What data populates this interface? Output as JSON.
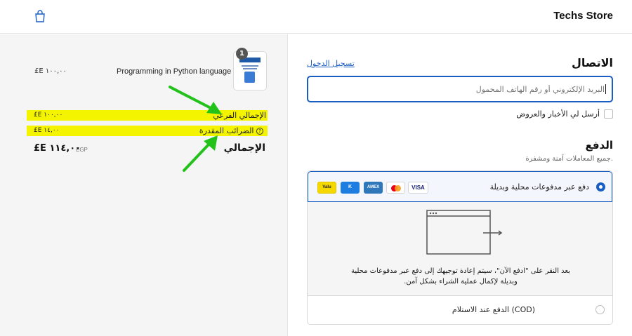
{
  "header": {
    "store_name": "Techs Store",
    "cart_icon": "shopping-bag-icon"
  },
  "summary": {
    "product": {
      "name": "Programming in Python language",
      "price": "£E ١٠٠,٠٠",
      "quantity": "1"
    },
    "subtotal_label": "الإجمالي الفرعي",
    "subtotal_value": "£E ١٠٠,٠٠",
    "tax_label": "الضرائب المقدرة",
    "tax_value": "£E ١٤,٠٠",
    "total_label": "الإجمالي",
    "total_currency": "EGP",
    "total_value": "£E ١١٤,٠٠",
    "highlight_color": "#f4f400",
    "arrow_color": "#22c21a"
  },
  "contact": {
    "title": "الاتصال",
    "login_link": "تسجيل الدخول",
    "email_placeholder": "البريد الإلكتروني أو رقم الهاتف المحمول",
    "newsletter_label": "أرسل لي الأخبار والعروض",
    "newsletter_checked": false
  },
  "payment": {
    "title": "الدفع",
    "subtitle": "جميع المعاملات آمنة ومشفرة.",
    "option_local": "دفع عبر مدفوعات محلية وبديلة",
    "option_local_selected": true,
    "cards": [
      "VISA",
      "mastercard",
      "AMEX",
      "K",
      "Valu"
    ],
    "redirect_text": "بعد النقر على \"ادفع الآن\"، سيتم إعادة توجيهك إلى دفع عبر مدفوعات محلية وبديلة لإكمال عملية الشراء بشكل آمن.",
    "option_cod": "الدفع عند الاستلام (COD)",
    "option_cod_selected": false,
    "accent_color": "#1a5ec4"
  }
}
